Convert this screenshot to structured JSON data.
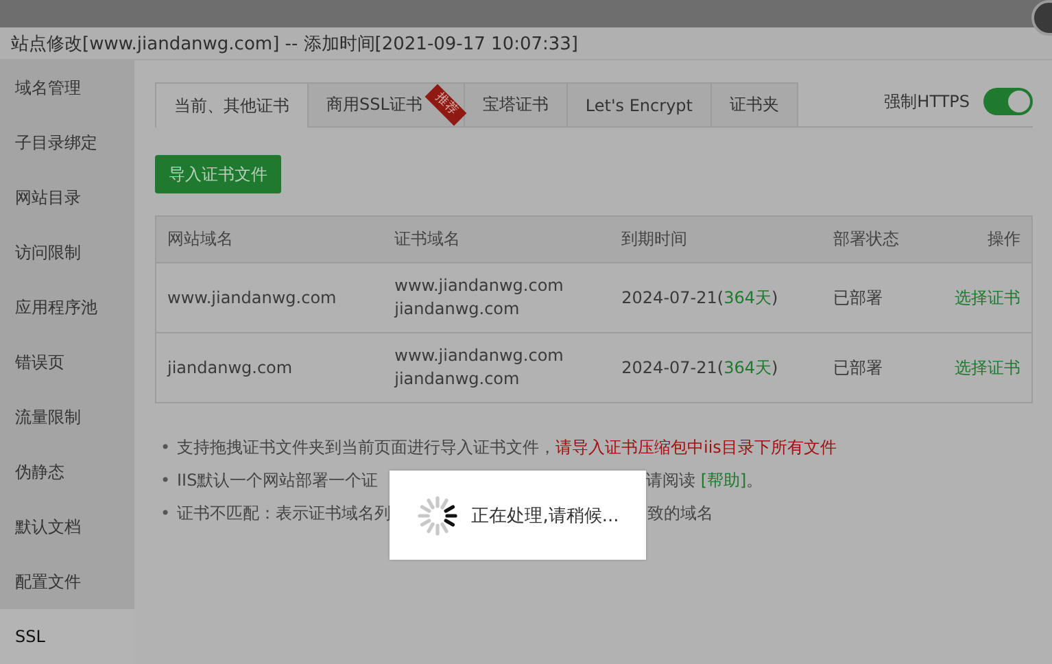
{
  "window": {
    "title": "站点修改[www.jiandanwg.com] -- 添加时间[2021-09-17 10:07:33]"
  },
  "sidebar": {
    "items": [
      {
        "label": "域名管理",
        "selected": false
      },
      {
        "label": "子目录绑定",
        "selected": false
      },
      {
        "label": "网站目录",
        "selected": false
      },
      {
        "label": "访问限制",
        "selected": false
      },
      {
        "label": "应用程序池",
        "selected": false
      },
      {
        "label": "错误页",
        "selected": false
      },
      {
        "label": "流量限制",
        "selected": false
      },
      {
        "label": "伪静态",
        "selected": false
      },
      {
        "label": "默认文档",
        "selected": false
      },
      {
        "label": "配置文件",
        "selected": false
      },
      {
        "label": "SSL",
        "selected": true
      }
    ]
  },
  "tabs": [
    {
      "label": "当前、其他证书",
      "selected": true
    },
    {
      "label": "商用SSL证书",
      "selected": false,
      "ribbon": "推荐"
    },
    {
      "label": "宝塔证书",
      "selected": false
    },
    {
      "label": "Let's Encrypt",
      "selected": false
    },
    {
      "label": "证书夹",
      "selected": false
    }
  ],
  "force_https": {
    "label": "强制HTTPS",
    "on": true
  },
  "import_button": "导入证书文件",
  "table": {
    "columns": [
      "网站域名",
      "证书域名",
      "到期时间",
      "部署状态",
      "操作"
    ],
    "rows": [
      {
        "site": "www.jiandanwg.com",
        "cert_domains": [
          "www.jiandanwg.com",
          "jiandanwg.com"
        ],
        "expiry": "2024-07-21(",
        "days": "364天",
        "expiry_end": ")",
        "status": "已部署",
        "action": "选择证书"
      },
      {
        "site": "jiandanwg.com",
        "cert_domains": [
          "www.jiandanwg.com",
          "jiandanwg.com"
        ],
        "expiry": "2024-07-21(",
        "days": "364天",
        "expiry_end": ")",
        "status": "已部署",
        "action": "选择证书"
      }
    ]
  },
  "notes": [
    {
      "bullet": "•",
      "lead": [
        {
          "kind": "text",
          "text": "支持拖拽证书文件夹到当前页面进行导入证书文件，"
        },
        {
          "kind": "warning",
          "text": "请导入证书压缩包中iis目录下所有文件"
        }
      ]
    },
    {
      "bullet": "•",
      "lead": [
        {
          "kind": "text",
          "text": "IIS默认一个网站部署一个证"
        }
      ],
      "tail": [
        {
          "kind": "text",
          "text": "请阅读 "
        },
        {
          "kind": "link",
          "text": "[帮助]"
        },
        {
          "kind": "text",
          "text": "。"
        }
      ]
    },
    {
      "bullet": "•",
      "lead": [
        {
          "kind": "text",
          "text": "证书不匹配：表示证书域名列"
        }
      ],
      "tail": [
        {
          "kind": "text",
          "text": "致的域名"
        }
      ]
    }
  ],
  "loading": {
    "message": "正在处理,请稍候..."
  }
}
